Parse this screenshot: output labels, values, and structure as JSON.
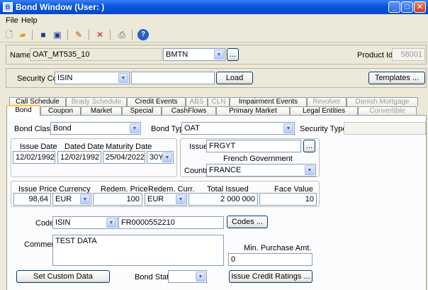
{
  "window": {
    "title": "Bond Window (User: )",
    "min": "_",
    "max": "□",
    "close": "✕"
  },
  "menu": [
    "File",
    "Help"
  ],
  "toolbar_icons": [
    "new-icon",
    "open-icon",
    "save-icon",
    "save-all-icon",
    "edit-icon",
    "delete-icon",
    "print-icon",
    "help-icon"
  ],
  "header": {
    "name_label": "Name",
    "name_value": "OAT_MT535_10",
    "type_value": "BMTN",
    "ellipsis": "...",
    "product_id_label": "Product Id",
    "product_id_value": "58001"
  },
  "security": {
    "label": "Security Code",
    "code_type": "ISIN",
    "code_value": "",
    "load": "Load",
    "templates": "Templates ..."
  },
  "tabs_row1": [
    {
      "label": "Call Schedule",
      "disabled": false
    },
    {
      "label": "Brady Schedule",
      "disabled": true
    },
    {
      "label": "Credit Events",
      "disabled": false
    },
    {
      "label": "ABS",
      "disabled": true
    },
    {
      "label": "CLN",
      "disabled": true
    },
    {
      "label": "Impairment Events",
      "disabled": false
    },
    {
      "label": "Revolver",
      "disabled": true
    },
    {
      "label": "Danish Mortgage",
      "disabled": true
    }
  ],
  "tabs_row2": [
    {
      "label": "Bond",
      "disabled": false
    },
    {
      "label": "Coupon",
      "disabled": false
    },
    {
      "label": "Market",
      "disabled": false
    },
    {
      "label": "Special",
      "disabled": false
    },
    {
      "label": "CashFlows",
      "disabled": false
    },
    {
      "label": "Primary Market",
      "disabled": false
    },
    {
      "label": "Legal Entities",
      "disabled": false
    },
    {
      "label": "Convertible",
      "disabled": true
    }
  ],
  "bond": {
    "class_label": "Bond Class",
    "class_value": "Bond",
    "type_label": "Bond Type",
    "type_value": "OAT",
    "sec_type_label": "Security Type",
    "sec_type_value": "",
    "issue_date_label": "Issue Date",
    "issue_date": "12/02/1992",
    "dated_date_label": "Dated Date",
    "dated_date": "12/02/1992",
    "maturity_label": "Maturity Date",
    "maturity_date": "25/04/2022",
    "tenor": "30Y",
    "issuer_label": "Issuer",
    "issuer_value": "FRGYT",
    "issuer_name": "French Government",
    "country_label": "Country",
    "country_value": "FRANCE",
    "issue_price_label": "Issue Price",
    "issue_price": "98,64",
    "currency_label": "Currency",
    "currency": "EUR",
    "redem_price_label": "Redem. Price",
    "redem_price": "100",
    "redem_curr_label": "Redem. Curr.",
    "redem_curr": "EUR",
    "total_issued_label": "Total Issued",
    "total_issued": "2 000 000",
    "face_value_label": "Face Value",
    "face_value": "10",
    "code_label": "Code",
    "code_type": "ISIN",
    "code_value": "FR0000552210",
    "codes_button": "Codes ...",
    "comment_label": "Comment",
    "comment_value": "TEST DATA",
    "min_purchase_label": "Min. Purchase Amt.",
    "min_purchase_value": "0",
    "set_custom_data": "Set Custom Data",
    "bond_status_label": "Bond Status",
    "bond_status_value": "",
    "issue_credit_ratings": "Issue Credit Ratings ..."
  }
}
